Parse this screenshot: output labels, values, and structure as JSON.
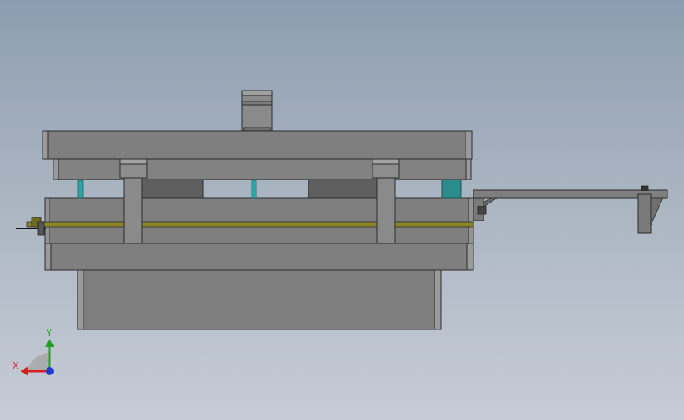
{
  "viewport": {
    "background_top": "#8d9db1",
    "background_bottom": "#c6ccd6"
  },
  "model": {
    "plate_color": "#7f7f7f",
    "plate_light_color": "#8c8c8c",
    "insert_color": "#5f5f5f",
    "spring_color": "#2aa6a6",
    "block_color": "#2a8c8c",
    "strip_color": "#8a8526"
  },
  "triad": {
    "x_label": "X",
    "y_label": "Y",
    "x_color": "#d42020",
    "y_color": "#21a021",
    "z_color": "#1d3bd0",
    "icons": [
      "coordinate-triad-icon"
    ]
  }
}
